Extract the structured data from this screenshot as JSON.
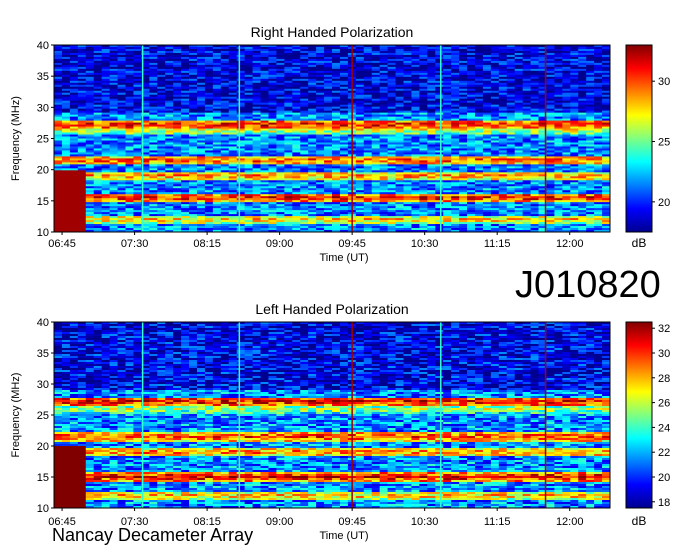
{
  "page": {
    "title": "J010820",
    "footer": "Nancay Decameter Array"
  },
  "colormap": [
    "#00008f",
    "#0000ff",
    "#0080ff",
    "#00ffff",
    "#80ff80",
    "#ffff00",
    "#ff8000",
    "#ff0000",
    "#800000"
  ],
  "chart_data": [
    {
      "type": "heatmap",
      "title": "Right Handed Polarization",
      "xlabel": "Time (UT)",
      "ylabel": "Frequency (MHz)",
      "x_ticks": [
        "06:45",
        "07:30",
        "08:15",
        "09:00",
        "09:45",
        "10:30",
        "11:15",
        "12:00"
      ],
      "y_ticks": [
        10,
        15,
        20,
        25,
        30,
        35,
        40
      ],
      "ylim": [
        10,
        40
      ],
      "colorbar": {
        "label": "dB",
        "ticks": [
          20,
          25,
          30
        ],
        "range": [
          17.5,
          33
        ]
      },
      "bands_mhz": [
        {
          "freq": 27.2,
          "level": 31
        },
        {
          "freq": 26.4,
          "level": 27
        },
        {
          "freq": 21.5,
          "level": 30
        },
        {
          "freq": 19.0,
          "level": 29
        },
        {
          "freq": 15.5,
          "level": 31
        },
        {
          "freq": 12.0,
          "level": 28
        }
      ],
      "vertical_lines_time": [
        "07:35",
        "08:35",
        "09:45",
        "10:40",
        "11:45"
      ]
    },
    {
      "type": "heatmap",
      "title": "Left Handed Polarization",
      "xlabel": "Time (UT)",
      "ylabel": "Frequency (MHz)",
      "x_ticks": [
        "06:45",
        "07:30",
        "08:15",
        "09:00",
        "09:45",
        "10:30",
        "11:15",
        "12:00"
      ],
      "y_ticks": [
        10,
        15,
        20,
        25,
        30,
        35,
        40
      ],
      "ylim": [
        10,
        40
      ],
      "colorbar": {
        "label": "dB",
        "ticks": [
          18,
          20,
          22,
          24,
          26,
          28,
          30,
          32
        ],
        "range": [
          17.5,
          32.5
        ]
      },
      "bands_mhz": [
        {
          "freq": 27.2,
          "level": 31
        },
        {
          "freq": 26.0,
          "level": 26
        },
        {
          "freq": 21.5,
          "level": 30
        },
        {
          "freq": 19.0,
          "level": 29
        },
        {
          "freq": 15.0,
          "level": 31
        },
        {
          "freq": 12.0,
          "level": 28
        }
      ],
      "vertical_lines_time": [
        "07:35",
        "08:35",
        "09:45",
        "10:40",
        "11:45"
      ]
    }
  ]
}
